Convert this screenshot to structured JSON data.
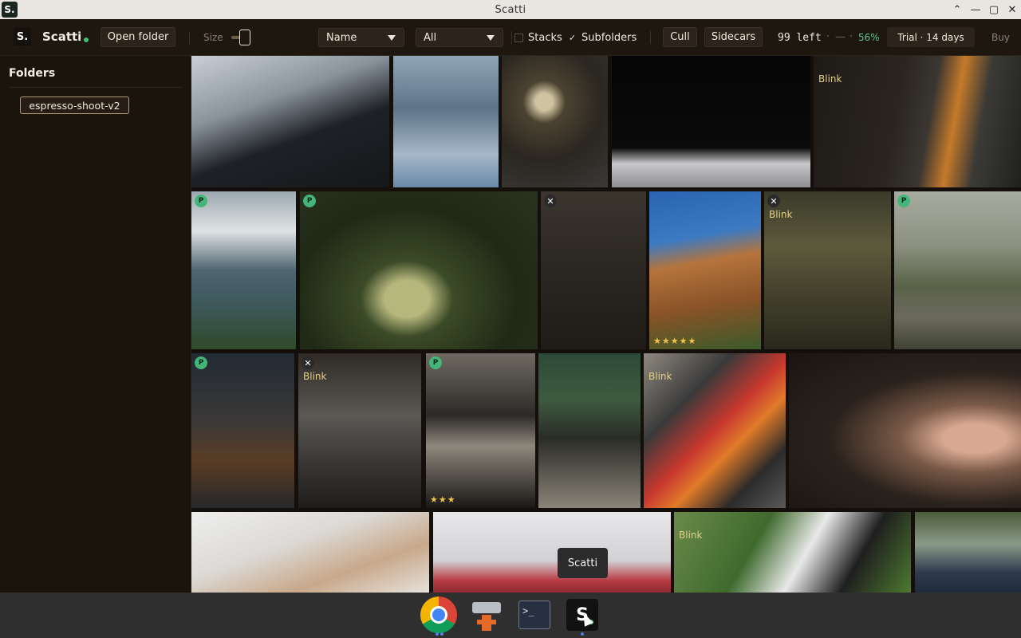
{
  "window": {
    "title": "Scatti",
    "app_badge": "S.",
    "controls": [
      "⌃",
      "—",
      "▢",
      "✕"
    ]
  },
  "toolbar": {
    "brand": "Scatti",
    "brand_logo": "S.",
    "open_folder": "Open folder",
    "size_label": "Size",
    "sort": {
      "selected": "Name"
    },
    "filter": {
      "selected": "All"
    },
    "stacks": {
      "label": "Stacks",
      "checked": false
    },
    "subfolders": {
      "label": "Subfolders",
      "checked": true,
      "mark": "✓"
    },
    "cull": "Cull",
    "sidecars": "Sidecars",
    "left_count": "99 left",
    "progress_dashes": [
      "·",
      "—",
      "·"
    ],
    "progress_pct": "56%",
    "trial": "Trial · 14 days",
    "buy": "Buy",
    "accent_color": "#3fbf78"
  },
  "sidebar": {
    "heading": "Folders",
    "folders": [
      "espresso-shoot-v2"
    ]
  },
  "grid": {
    "pick_label": "P",
    "reject_label": "✕",
    "blink_label": "Blink",
    "tiles": [
      {
        "name": "tile-y3-jackets",
        "status": null,
        "blink": false,
        "stars": ""
      },
      {
        "name": "tile-street-fashion",
        "status": null,
        "blink": false,
        "stars": ""
      },
      {
        "name": "tile-classic-car-headlight",
        "status": null,
        "blink": false,
        "stars": ""
      },
      {
        "name": "tile-fencing",
        "status": null,
        "blink": false,
        "stars": ""
      },
      {
        "name": "tile-orange-porsche-street",
        "status": null,
        "blink": true,
        "stars": ""
      },
      {
        "name": "tile-lake-mountains",
        "status": "pick",
        "blink": false,
        "stars": ""
      },
      {
        "name": "tile-green-porsche",
        "status": "pick",
        "blink": false,
        "stars": ""
      },
      {
        "name": "tile-coffee-shop-street",
        "status": "reject",
        "blink": false,
        "stars": ""
      },
      {
        "name": "tile-wooden-tower",
        "status": null,
        "blink": false,
        "stars": "★★★★★"
      },
      {
        "name": "tile-interior-plants",
        "status": "reject",
        "blink": true,
        "stars": ""
      },
      {
        "name": "tile-forest-cyclist",
        "status": "pick",
        "blink": false,
        "stars": ""
      },
      {
        "name": "tile-brick-building",
        "status": "pick",
        "blink": false,
        "stars": ""
      },
      {
        "name": "tile-car-garage",
        "status": "reject",
        "blink": true,
        "stars": ""
      },
      {
        "name": "tile-record-player",
        "status": "pick",
        "blink": false,
        "stars": "★★★"
      },
      {
        "name": "tile-village-street",
        "status": null,
        "blink": false,
        "stars": ""
      },
      {
        "name": "tile-record-store-posters",
        "status": null,
        "blink": true,
        "stars": ""
      },
      {
        "name": "tile-bride-bouquet",
        "status": null,
        "blink": false,
        "stars": ""
      },
      {
        "name": "tile-wedding-hands",
        "status": null,
        "blink": false,
        "stars": ""
      },
      {
        "name": "tile-balloons-flowers",
        "status": null,
        "blink": false,
        "stars": ""
      },
      {
        "name": "tile-holding-hands-grass",
        "status": null,
        "blink": true,
        "stars": ""
      },
      {
        "name": "tile-wedding-crowd",
        "status": null,
        "blink": false,
        "stars": ""
      }
    ]
  },
  "tooltip": "Scatti",
  "dock": {
    "items": [
      "chrome-icon",
      "gnome-software-icon",
      "terminal-icon",
      "scatti-icon"
    ],
    "terminal_prompt": ">_",
    "scatti_letter": "S"
  }
}
